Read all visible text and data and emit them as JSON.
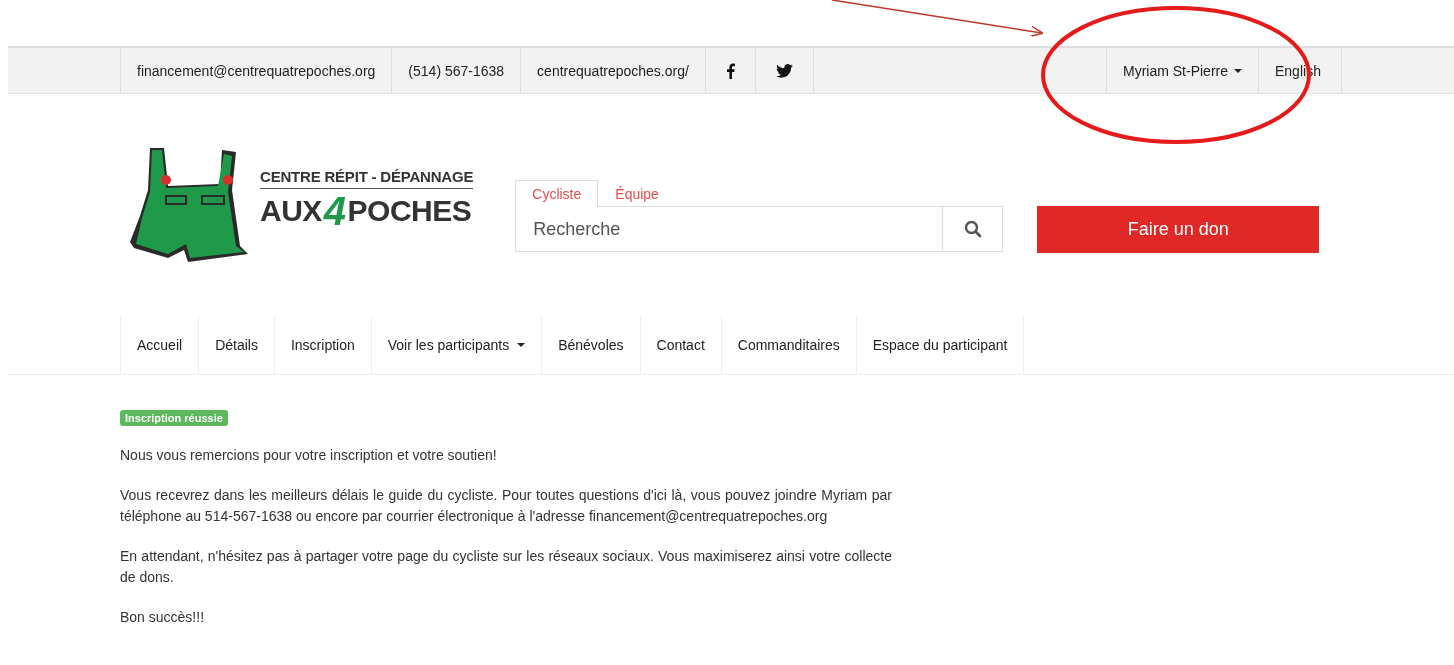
{
  "annotation": {
    "shown": true
  },
  "top_bar": {
    "email": "financement@centrequatrepoches.org",
    "phone": "(514) 567-1638",
    "website": "centrequatrepoches.org/",
    "social": [
      {
        "kind": "facebook"
      },
      {
        "kind": "twitter"
      }
    ],
    "user": "Myriam St-Pierre",
    "language": "English"
  },
  "logo": {
    "tagline": "CENTRE RÉPIT - DÉPANNAGE",
    "name_start": "AUX",
    "number": "4",
    "name_end": "POCHES"
  },
  "search": {
    "tabs": [
      {
        "label": "Cycliste",
        "selected": true
      },
      {
        "label": "Équipe",
        "selected": false
      }
    ],
    "placeholder": "Recherche"
  },
  "donate_button": "Faire un don",
  "nav": [
    {
      "label": "Accueil",
      "dropdown": false
    },
    {
      "label": "Détails",
      "dropdown": false
    },
    {
      "label": "Inscription",
      "dropdown": false
    },
    {
      "label": "Voir les participants",
      "dropdown": true
    },
    {
      "label": "Bénévoles",
      "dropdown": false
    },
    {
      "label": "Contact",
      "dropdown": false
    },
    {
      "label": "Commanditaires",
      "dropdown": false
    },
    {
      "label": "Espace du participant",
      "dropdown": false
    }
  ],
  "status_badge": "Inscription réussie",
  "paragraphs": [
    "Nous vous remercions pour votre inscription et votre soutien!",
    "Vous recevrez dans les meilleurs délais le guide du cycliste. Pour toutes questions d'ici là, vous pouvez joindre Myriam par téléphone au 514-567-1638 ou encore par courrier électronique à l'adresse financement@centrequatrepoches.org",
    "En attendant, n'hésitez pas à partager votre page du cycliste sur les réseaux sociaux. Vous maximiserez ainsi votre collecte de dons.",
    "Bon succès!!!"
  ]
}
